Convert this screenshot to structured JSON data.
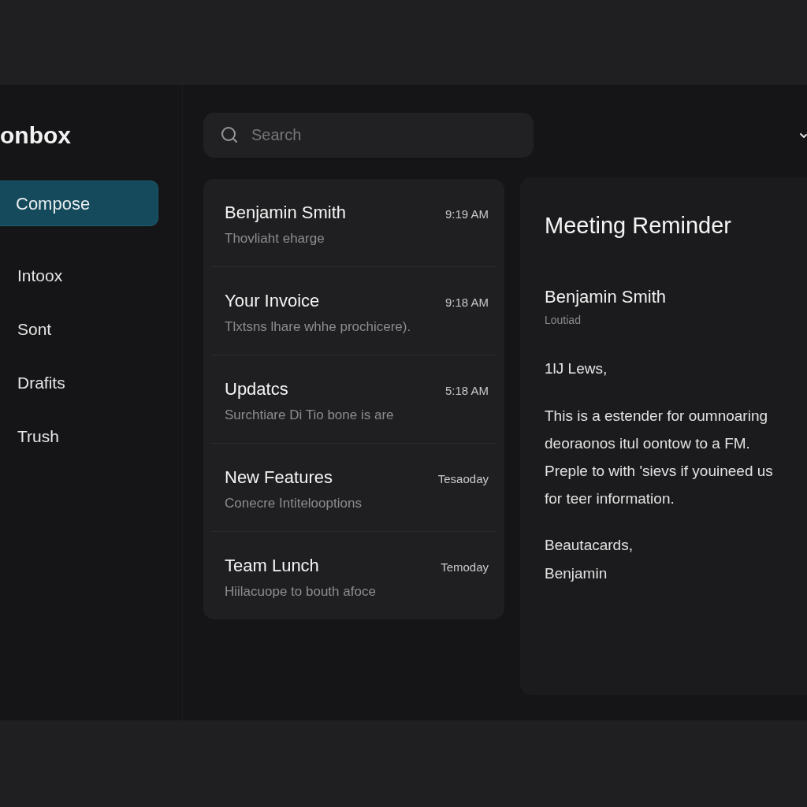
{
  "sidebar": {
    "title": "onbox",
    "compose_button": "Compose",
    "items": [
      {
        "label": "Intoox"
      },
      {
        "label": "Sont"
      },
      {
        "label": "Drafits"
      },
      {
        "label": "Trush"
      }
    ]
  },
  "search": {
    "placeholder": "Search"
  },
  "messages": [
    {
      "subject": "Benjamin Smith",
      "time": "9:19 AM",
      "preview": "Thovliaht eharge"
    },
    {
      "subject": "Your Invoice",
      "time": "9:18 AM",
      "preview": "Tlxtsns lhare whhe prochicere)."
    },
    {
      "subject": "Updatcs",
      "time": "5:18 AM",
      "preview": "Surchtiare Di Tio bone is are"
    },
    {
      "subject": "New Features",
      "time": "Tesaoday",
      "preview": "Conecre Intitelooptions"
    },
    {
      "subject": "Team Lunch",
      "time": "Temoday",
      "preview": "Hiilacuope to bouth afoce"
    }
  ],
  "reading_pane": {
    "subject": "Meeting Reminder",
    "sender": "Benjamin Smith",
    "sender_detail": "Loutiad",
    "greeting": "1lJ Lews,",
    "body_lines": [
      "This is a estender for oumnoaring",
      "deoraonos itul oontow to a FM.",
      "Preple to with 'sievs if youineed us",
      "for teer information."
    ],
    "closing_lines": [
      "Beautacards,",
      "Benjamin"
    ]
  }
}
